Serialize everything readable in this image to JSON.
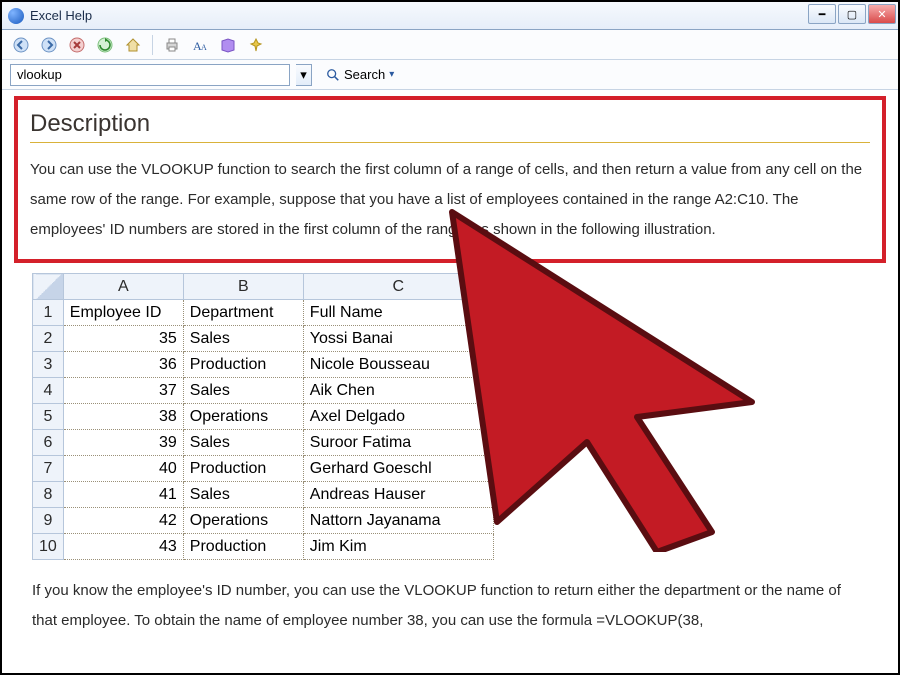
{
  "window": {
    "title": "Excel Help"
  },
  "search": {
    "value": "vlookup",
    "button": "Search",
    "dropdown_glyph": "▾"
  },
  "description": {
    "heading": "Description",
    "body": "You can use the VLOOKUP function to search the first column of a range of cells, and then return a value from any cell on the same row of the range. For example, suppose that you have a list of employees contained in the range A2:C10. The employees' ID numbers are stored in the first column of the range, as shown in the following illustration."
  },
  "table": {
    "columns": [
      "A",
      "B",
      "C"
    ],
    "header_row": [
      "Employee ID",
      "Department",
      "Full Name"
    ],
    "rows": [
      {
        "n": 1,
        "a": "Employee ID",
        "b": "Department",
        "c": "Full Name",
        "hdr": true
      },
      {
        "n": 2,
        "a": "35",
        "b": "Sales",
        "c": "Yossi Banai"
      },
      {
        "n": 3,
        "a": "36",
        "b": "Production",
        "c": "Nicole Bousseau"
      },
      {
        "n": 4,
        "a": "37",
        "b": "Sales",
        "c": "Aik Chen"
      },
      {
        "n": 5,
        "a": "38",
        "b": "Operations",
        "c": "Axel Delgado"
      },
      {
        "n": 6,
        "a": "39",
        "b": "Sales",
        "c": "Suroor Fatima"
      },
      {
        "n": 7,
        "a": "40",
        "b": "Production",
        "c": "Gerhard Goeschl"
      },
      {
        "n": 8,
        "a": "41",
        "b": "Sales",
        "c": "Andreas Hauser"
      },
      {
        "n": 9,
        "a": "42",
        "b": "Operations",
        "c": "Nattorn Jayanama"
      },
      {
        "n": 10,
        "a": "43",
        "b": "Production",
        "c": "Jim Kim"
      }
    ]
  },
  "after_text": "If you know the employee's ID number, you can use the VLOOKUP function to return either the department or the name of that employee. To obtain the name of employee number 38, you can use the formula =VLOOKUP(38,",
  "colors": {
    "highlight_border": "#d4202a"
  }
}
